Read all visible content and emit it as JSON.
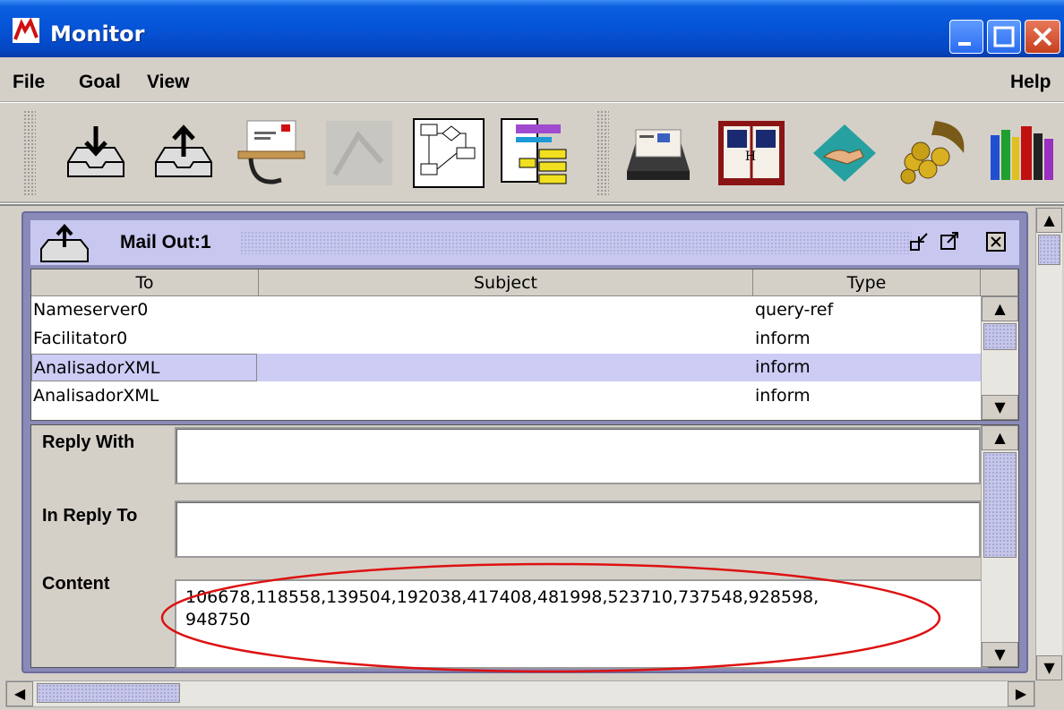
{
  "window": {
    "title": "Monitor"
  },
  "menu": {
    "file": "File",
    "goal": "Goal",
    "view": "View",
    "help": "Help"
  },
  "toolbar": {
    "tools": [
      "inbox-icon",
      "outbox-icon",
      "mail-tray-icon",
      "disabled-tool-icon",
      "flowchart-icon",
      "data-tree-icon",
      "rolodex-icon",
      "dictionary-icon",
      "handshake-icon",
      "cornucopia-icon",
      "library-icon"
    ]
  },
  "frame": {
    "title": "Mail Out:1"
  },
  "table": {
    "headers": {
      "to": "To",
      "subject": "Subject",
      "type": "Type"
    },
    "rows": [
      {
        "to": "Nameserver0",
        "subject": "",
        "type": "query-ref"
      },
      {
        "to": "Facilitator0",
        "subject": "",
        "type": "inform"
      },
      {
        "to": "AnalisadorXML",
        "subject": "",
        "type": "inform"
      },
      {
        "to": "AnalisadorXML",
        "subject": "",
        "type": "inform"
      }
    ]
  },
  "details": {
    "reply_with_label": "Reply With",
    "in_reply_to_label": "In Reply To",
    "content_label": "Content",
    "content_line1": "106678,118558,139504,192038,417408,481998,523710,737548,928598,",
    "content_line2": "948750"
  },
  "colors": {
    "titlebar": "#0653d6",
    "selection": "#ccccf5",
    "annotation": "#dd1111"
  }
}
